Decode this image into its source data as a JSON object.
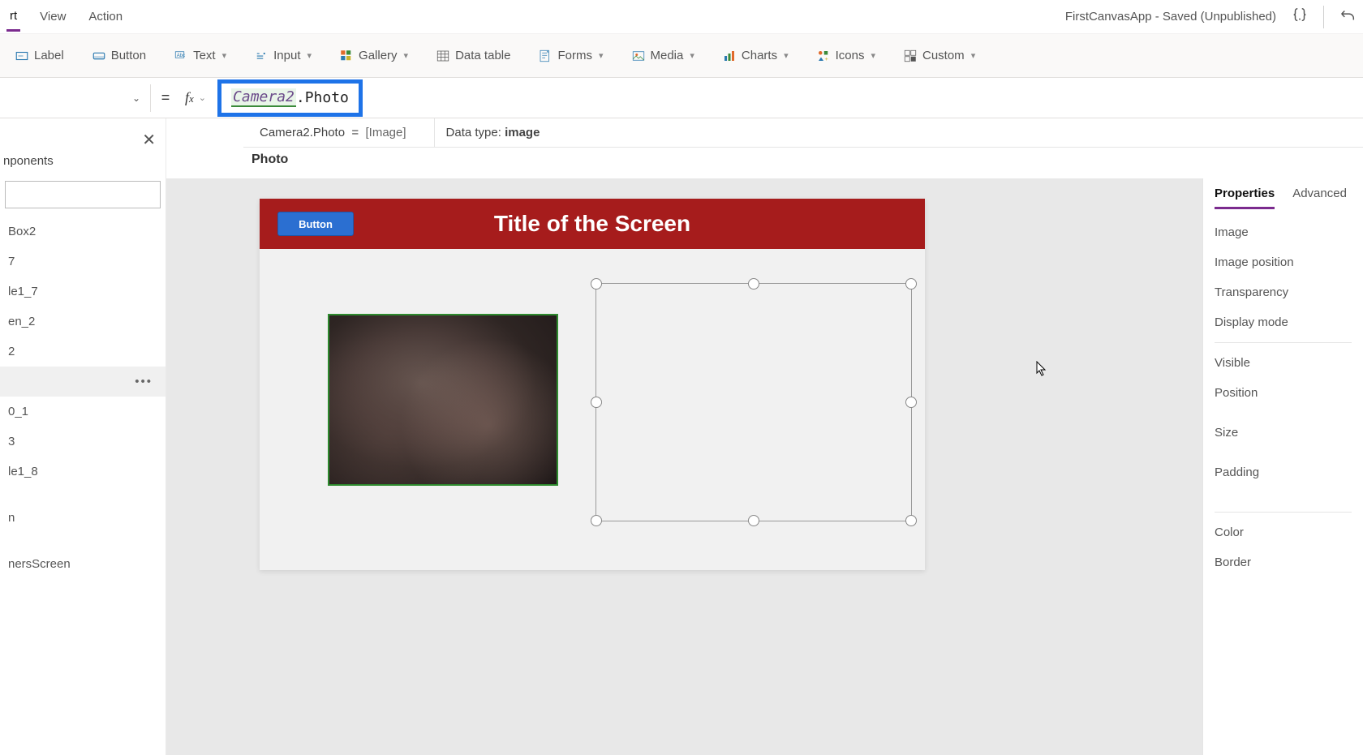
{
  "topMenu": {
    "items": [
      "rt",
      "View",
      "Action"
    ],
    "appTitle": "FirstCanvasApp - Saved (Unpublished)"
  },
  "ribbon": {
    "label": "Label",
    "button": "Button",
    "text": "Text",
    "input": "Input",
    "gallery": "Gallery",
    "dataTable": "Data table",
    "forms": "Forms",
    "media": "Media",
    "charts": "Charts",
    "icons": "Icons",
    "custom": "Custom"
  },
  "formula": {
    "token1": "Camera2",
    "token2": ".Photo",
    "evalLeft": "Camera2.Photo",
    "evalEqImage": "[Image]",
    "dtLabel": "Data type: ",
    "dtValue": "image",
    "photoHeading": "Photo"
  },
  "tree": {
    "tab": "nponents",
    "close": "✕",
    "items": [
      "Box2",
      "7",
      "le1_7",
      "en_2",
      "2",
      "",
      "0_1",
      "3",
      "le1_8",
      "",
      "n",
      "",
      "nersScreen"
    ],
    "selectedIndex": 5
  },
  "screen": {
    "button": "Button",
    "title": "Title of the Screen"
  },
  "props": {
    "tabs": {
      "properties": "Properties",
      "advanced": "Advanced"
    },
    "rows1": [
      "Image",
      "Image position",
      "Transparency",
      "Display mode"
    ],
    "rows2": [
      "Visible",
      "Position",
      "Size",
      "Padding"
    ],
    "rows3": [
      "Color",
      "Border"
    ]
  }
}
